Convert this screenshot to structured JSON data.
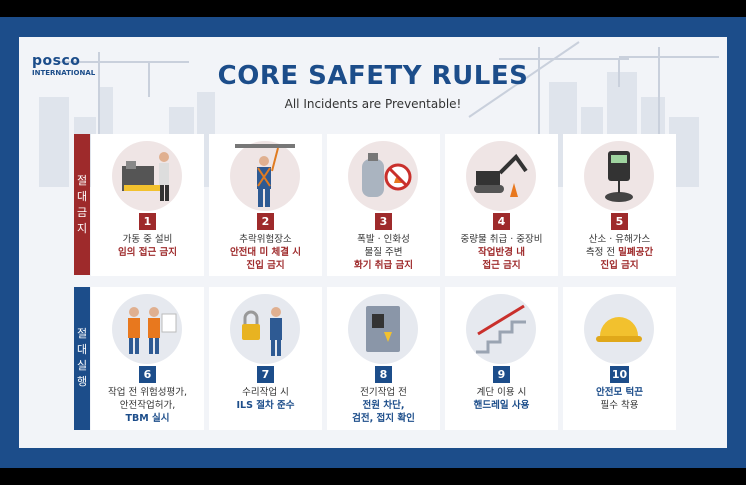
{
  "brand": {
    "name": "posco",
    "sub": "INTERNATIONAL"
  },
  "title": "CORE SAFETY RULES",
  "subtitle": "All Incidents are Preventable!",
  "colors": {
    "border": "#1c4d8a",
    "prohibited": "#9e2a2b",
    "mandatory": "#1c4d8a"
  },
  "sections": {
    "prohibited": {
      "label": [
        "절",
        "대",
        "금",
        "지"
      ]
    },
    "mandatory": {
      "label": [
        "절",
        "대",
        "실",
        "행"
      ]
    }
  },
  "rules": [
    {
      "number": "1",
      "lines": [
        "가동 중 설비"
      ],
      "bold": [
        "임의 접근 금지"
      ],
      "icon": "machine-worker-icon"
    },
    {
      "number": "2",
      "lines": [
        "추락위험장소"
      ],
      "bold": [
        "안전대 미 체결 시",
        "진입 금지"
      ],
      "icon": "harness-worker-icon"
    },
    {
      "number": "3",
      "lines": [
        "폭발 · 인화성",
        "물질 주변"
      ],
      "bold": [
        "화기 취급 금지"
      ],
      "icon": "gas-cylinder-icon"
    },
    {
      "number": "4",
      "lines": [
        "중량물 취급 · 중장비"
      ],
      "bold": [
        "작업반경 내",
        "접근 금지"
      ],
      "icon": "excavator-icon"
    },
    {
      "number": "5",
      "lines": [
        "산소 · 유해가스",
        "측정 전"
      ],
      "inline_bold": "밀폐공간",
      "bold": [
        "진입 금지"
      ],
      "icon": "gas-detector-icon"
    },
    {
      "number": "6",
      "lines": [
        "작업 전 위험성평가,",
        "안전작업허가,"
      ],
      "bold": [
        "TBM 실시"
      ],
      "icon": "meeting-workers-icon"
    },
    {
      "number": "7",
      "lines": [
        "수리작업 시"
      ],
      "bold": [
        "ILS 절차 준수"
      ],
      "icon": "lock-worker-icon"
    },
    {
      "number": "8",
      "lines": [
        "전기작업 전"
      ],
      "bold": [
        "전원 차단,",
        "검전, 접지 확인"
      ],
      "icon": "electric-panel-icon"
    },
    {
      "number": "9",
      "lines": [
        "계단 이용 시"
      ],
      "bold": [
        "핸드레일 사용"
      ],
      "icon": "stair-handrail-icon"
    },
    {
      "number": "10",
      "lines": [],
      "bold": [
        "안전모 턱끈"
      ],
      "after": [
        "필수 착용"
      ],
      "icon": "hardhat-icon"
    }
  ]
}
